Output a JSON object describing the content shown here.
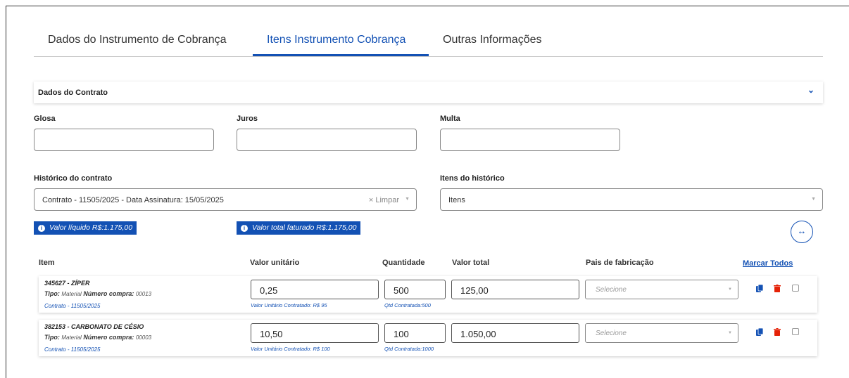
{
  "tabs": [
    {
      "label": "Dados do Instrumento de Cobrança",
      "active": false
    },
    {
      "label": "Itens Instrumento Cobrança",
      "active": true
    },
    {
      "label": "Outras Informações",
      "active": false
    }
  ],
  "section": {
    "title": "Dados do Contrato",
    "icon": "chevron-down-icon"
  },
  "form": {
    "glosa_label": "Glosa",
    "glosa_value": "",
    "juros_label": "Juros",
    "juros_value": "",
    "multa_label": "Multa",
    "multa_value": "",
    "historico_label": "Histórico do contrato",
    "historico_value": "Contrato - 11505/2025 - Data Assinatura: 15/05/2025",
    "limpar_label": "× Limpar",
    "itens_historico_label": "Itens do histórico",
    "itens_historico_placeholder": "Itens"
  },
  "badges": {
    "valor_liquido": "Valor líquido R$:1.175,00",
    "valor_total_faturado": "Valor total faturado R$:1.175,00"
  },
  "columns": {
    "item": "Item",
    "valor_unitario": "Valor unitário",
    "quantidade": "Quantidade",
    "valor_total": "Valor total",
    "pais": "Pais de fabricação",
    "marcar_todos": "Marcar Todos"
  },
  "rows": [
    {
      "code": "345627 - ZÍPER",
      "tipo_label": "Tipo:",
      "tipo_value": "Material",
      "numero_label": "Número compra:",
      "numero_value": "00013",
      "contrato": "Contrato - 11505/2025",
      "valor_unitario": "0,25",
      "valor_unitario_hint": "Valor Unitário Contratado: R$ 95",
      "quantidade": "500",
      "quantidade_hint": "Qtd Contratada:500",
      "valor_total": "125,00",
      "pais_placeholder": "Selecione"
    },
    {
      "code": "382153 - CARBONATO DE CÉSIO",
      "tipo_label": "Tipo:",
      "tipo_value": "Material",
      "numero_label": "Número compra:",
      "numero_value": "00003",
      "contrato": "Contrato - 11505/2025",
      "valor_unitario": "10,50",
      "valor_unitario_hint": "Valor Unitário Contratado: R$ 100",
      "quantidade": "100",
      "quantidade_hint": "Qtd Contratada:1000",
      "valor_total": "1.050,00",
      "pais_placeholder": "Selecione"
    }
  ],
  "colors": {
    "primary": "#1351b4",
    "danger": "#e52207"
  }
}
